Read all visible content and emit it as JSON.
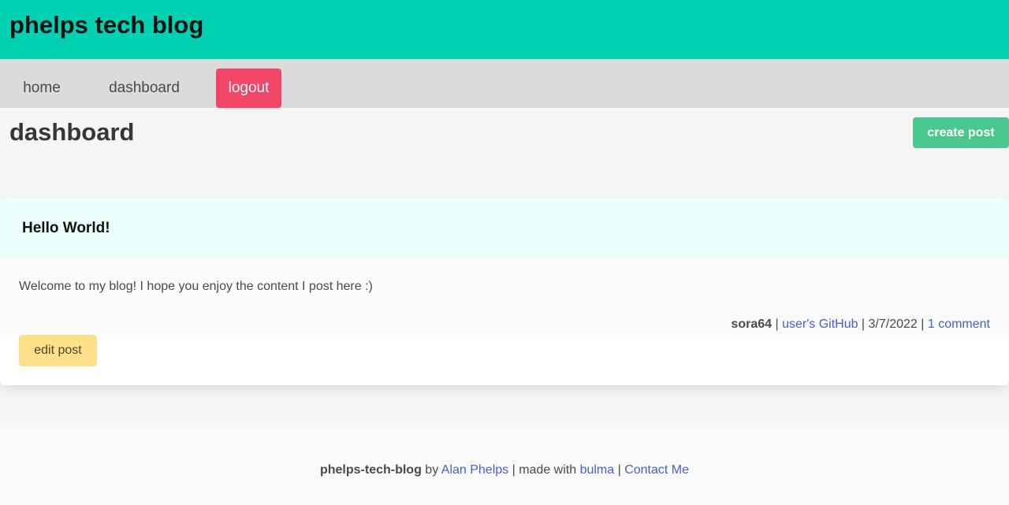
{
  "header": {
    "site_title": "phelps tech blog"
  },
  "nav": {
    "home": "home",
    "dashboard": "dashboard",
    "logout": "logout"
  },
  "page": {
    "heading": "dashboard",
    "create_label": "create post"
  },
  "post": {
    "title": "Hello World!",
    "body": "Welcome to my blog! I hope you enjoy the content I post here :)",
    "author": "sora64",
    "sep1": " | ",
    "github_link": "user's GitHub",
    "sep2": " | ",
    "date": "3/7/2022",
    "sep3": " | ",
    "comments_link": "1 comment",
    "edit_label": "edit post"
  },
  "footer": {
    "project": "phelps-tech-blog",
    "by": " by ",
    "author_link": "Alan Phelps",
    "made_with": " | made with ",
    "bulma_link": "bulma",
    "sep": " | ",
    "contact_link": "Contact Me"
  },
  "colors": {
    "header_bg": "#00d1b2",
    "logout_bg": "#f14668",
    "create_bg": "#48c78e",
    "edit_bg": "#ffe08a",
    "card_header_bg": "#ebfffc",
    "link": "#485fc7"
  }
}
